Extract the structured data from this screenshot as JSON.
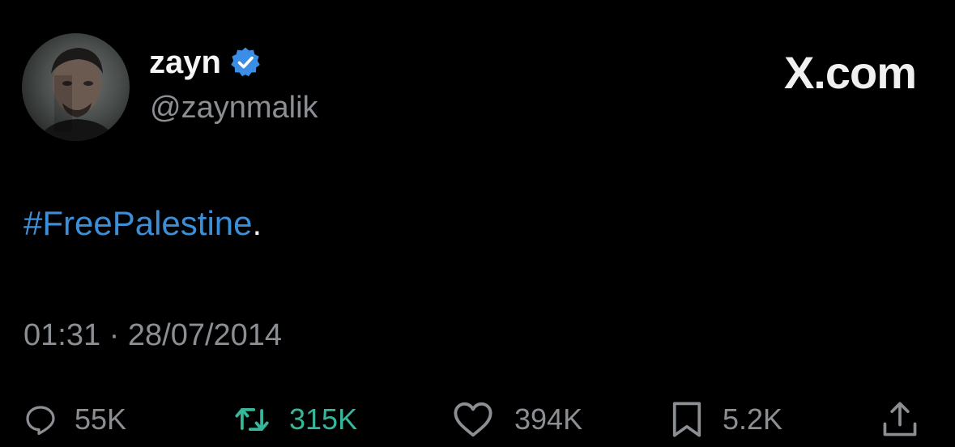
{
  "author": {
    "display_name": "zayn",
    "handle": "@zaynmalik",
    "verified": true,
    "avatar_icon": "profile-photo"
  },
  "brand": {
    "label": "X.com"
  },
  "tweet": {
    "hashtag": "#FreePalestine",
    "trailing": "."
  },
  "timestamp": "01:31 · 28/07/2014",
  "actions": {
    "replies": "55K",
    "retweets": "315K",
    "likes": "394K",
    "bookmarks": "5.2K"
  },
  "colors": {
    "background": "#000000",
    "hashtag": "#3b8ed8",
    "verified": "#3a8ee6",
    "retweet_active": "#36b79a",
    "muted": "#8b8f93"
  }
}
